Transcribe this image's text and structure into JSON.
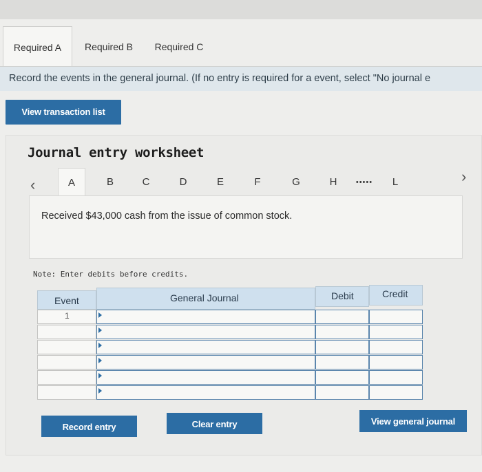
{
  "tabs": [
    {
      "label": "Required A",
      "active": true
    },
    {
      "label": "Required B",
      "active": false
    },
    {
      "label": "Required C",
      "active": false
    }
  ],
  "instruction": "Record the events in the general journal. (If no entry is required for a event, select \"No journal e",
  "view_transaction_list": "View transaction list",
  "worksheet": {
    "title": "Journal entry worksheet",
    "steps": [
      "A",
      "B",
      "C",
      "D",
      "E",
      "F",
      "G",
      "H",
      "•••••",
      "L"
    ],
    "active_step": "A",
    "prev_icon": "chevron-left-icon",
    "next_icon": "chevron-right-icon",
    "description": "Received $43,000 cash from the issue of common stock.",
    "note": "Note: Enter debits before credits."
  },
  "table": {
    "headers": {
      "event": "Event",
      "general_journal": "General Journal",
      "debit": "Debit",
      "credit": "Credit"
    },
    "event_number": "1",
    "row_count": 6
  },
  "buttons": {
    "record": "Record entry",
    "clear": "Clear entry",
    "view_general_journal": "View general journal"
  },
  "colors": {
    "button_blue": "#2c6da4",
    "header_blue": "#cfe0ee",
    "instruction_bg": "#dfe7ec"
  }
}
